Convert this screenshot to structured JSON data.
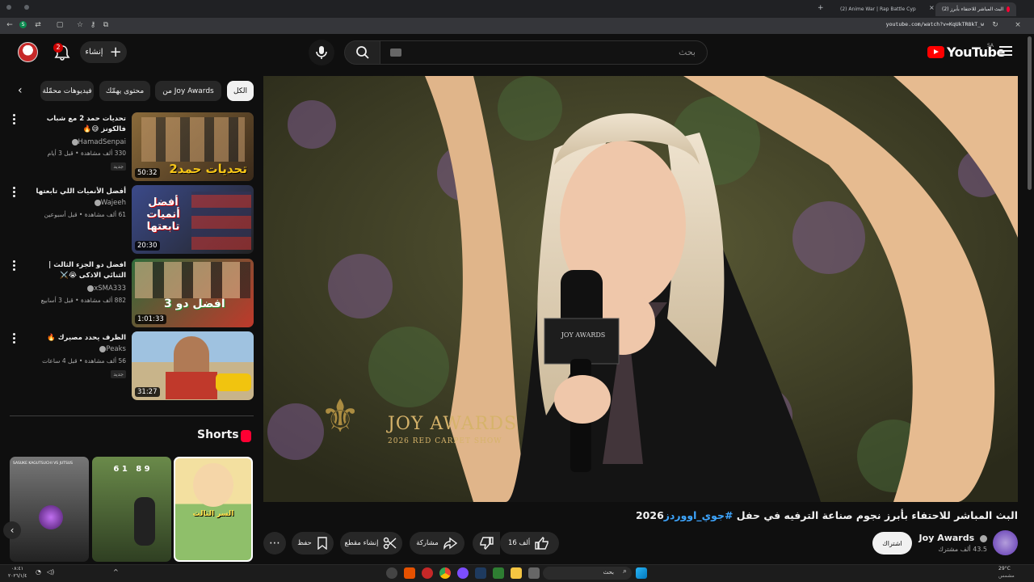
{
  "browser": {
    "tabs": [
      {
        "label": "(2) البث المباشر للاحتفاء بأبرز",
        "active": true
      },
      {
        "label": "(2) Anime War | Rap Battle Cyp",
        "active": false
      }
    ],
    "url": "youtube.com/watch?v=KqUkTR8kT_w"
  },
  "header": {
    "logo_text": "YouTube",
    "region": "SA",
    "search_placeholder": "بحث",
    "create_label": "إنشاء",
    "notification_count": "2"
  },
  "chips": [
    {
      "label": "الكل",
      "active": true
    },
    {
      "label": "من Joy Awards",
      "active": false
    },
    {
      "label": "محتوى يهمّك",
      "active": false
    },
    {
      "label": "فيديوهات محمّلة",
      "active": false
    }
  ],
  "recommendations": [
    {
      "title": "تحديات حمد 2 مع شباب فالكونز 😅🔥",
      "channel": "HamadSenpai",
      "meta": "330 ألف مشاهدة • قبل 3 أيام",
      "badge": "جديد",
      "duration": "50:32",
      "thumb_text": "تحديات حمد2",
      "thumb_color": "#7a5a2e"
    },
    {
      "title": "أفضل الأنميات اللي تابعتها",
      "channel": "Wajeeh",
      "meta": "61 ألف مشاهدة • قبل أسبوعين",
      "badge": "",
      "duration": "20:30",
      "thumb_text": "أفضل أنميات تابعتها",
      "thumb_color": "#3b4a8a"
    },
    {
      "title": "افضل دو الجزء الثالث | الثنائي الاذكى 😭⚔️",
      "channel": "xSMA333",
      "meta": "882 ألف مشاهدة • قبل 3 أسابيع",
      "badge": "",
      "duration": "1:01:33",
      "thumb_text": "افضل دو 3",
      "thumb_color": "#2e6b3a"
    },
    {
      "title": "الظرف يحدد مصيرك 🔥",
      "channel": "Peaks",
      "meta": "56 ألف مشاهدة • قبل 4 ساعات",
      "badge": "جديد",
      "duration": "31:27",
      "thumb_text": "",
      "thumb_color": "#6f8fb0"
    }
  ],
  "shorts": {
    "title": "Shorts",
    "items": [
      {
        "caption": "السر الثالث",
        "color": "#9bbd7a"
      },
      {
        "caption": "6 1   8 9",
        "color": "#4d6b3a"
      },
      {
        "caption": "SASUKE KAGUTSUCHI VS JUTSUS",
        "color": "#5a5a5a"
      }
    ]
  },
  "video": {
    "title": "البث المباشر للاحتفاء بأبرز نجوم صناعة الترفيه في حفل ",
    "hashtag": "#جوي_اووردز",
    "year": "2026",
    "watermark_title": "JOY AWARDS",
    "watermark_sub": "2026 RED CARPET SHOW",
    "mic_label": "JOY AWARDS",
    "channel": "Joy Awards",
    "subscribers": "43.5 ألف مشترك",
    "subscribe_label": "اشتراك",
    "likes": "16 ألف",
    "share_label": "مشاركة",
    "clip_label": "إنشاء مقطع",
    "save_label": "حفظ"
  },
  "taskbar": {
    "search_label": "بحث",
    "weather": "29°C",
    "weather_desc": "مشمس",
    "time": "٠٨:٤١",
    "date": "٢٠٢٦/١/٤"
  }
}
